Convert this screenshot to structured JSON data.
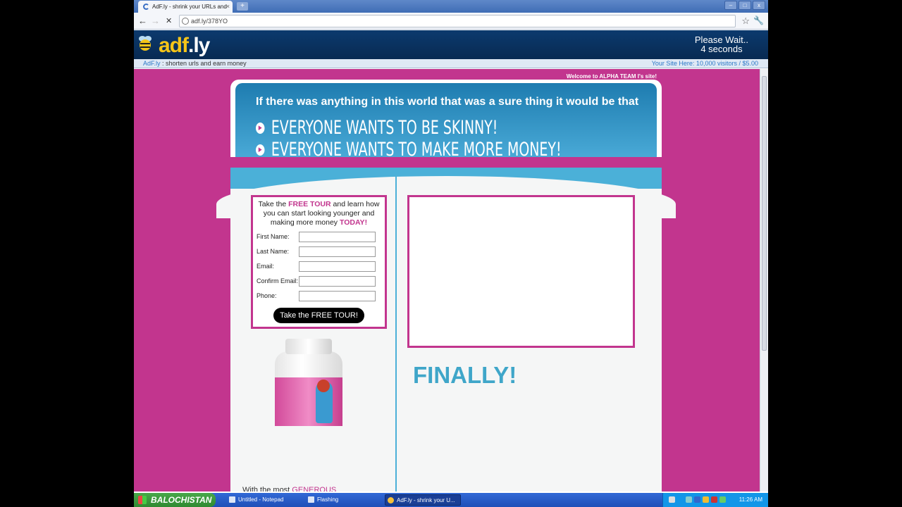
{
  "browser": {
    "tab_title": "AdF.ly - shrink your URLs and",
    "tab_close": "×",
    "new_tab": "+",
    "url": "adf.ly/378YO",
    "back": "←",
    "forward": "→",
    "stop": "✕",
    "star": "☆",
    "wrench": "🔧",
    "win_min": "–",
    "win_max": "□",
    "win_close": "x"
  },
  "adfly": {
    "logo_ad": "adf",
    "logo_ly": ".ly",
    "wait_line1": "Please Wait..",
    "wait_line2": "4 seconds",
    "info_brand": "AdF.ly",
    "info_text": ": shorten urls and earn money",
    "info_right": "Your Site Here: 10,000 visitors / $5.00"
  },
  "page": {
    "welcome": "Welcome to ALPHA TEAM I's site!",
    "hero_title": "If there was anything in this world that was a sure thing it would be that",
    "hero_lines": [
      "EVERYONE WANTS TO BE SKINNY!",
      "EVERYONE WANTS TO MAKE MORE MONEY!"
    ],
    "form": {
      "intro_a": "Take the ",
      "intro_b": "FREE TOUR",
      "intro_c": " and learn how you can start looking younger and making more money ",
      "intro_d": "TODAY!",
      "fields": [
        "First Name:",
        "Last Name:",
        "Email:",
        "Confirm Email:",
        "Phone:"
      ],
      "button": "Take the FREE TOUR!"
    },
    "finally": "FINALLY!",
    "bottom_a": "With the most ",
    "bottom_b": "GENEROUS"
  },
  "taskbar": {
    "start": "BALOCHISTAN",
    "tasks": [
      "Untitled - Notepad",
      "Flashing",
      "AdF.ly - shrink your U..."
    ],
    "clock": "11:26 AM"
  },
  "colors": {
    "page_bg": "#c2358e",
    "accent_blue": "#4bb0d8",
    "adfly_bar": "#0c3a6e"
  }
}
